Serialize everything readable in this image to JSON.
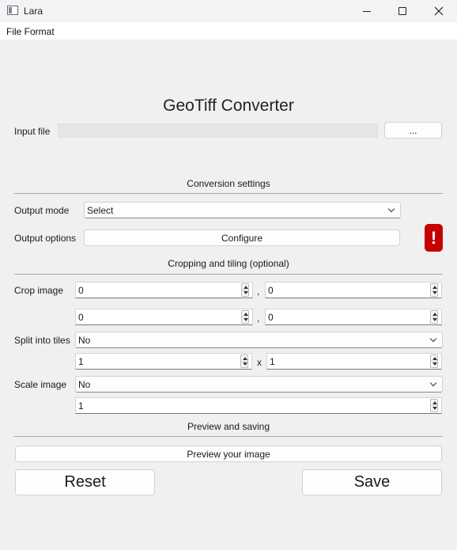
{
  "window": {
    "title": "Lara",
    "icon": "app-window-icon"
  },
  "menu": {
    "items": [
      "File Format"
    ]
  },
  "heading": "GeoTiff Converter",
  "input_file": {
    "label": "Input file",
    "value": "",
    "browse_label": "..."
  },
  "conversion": {
    "title": "Conversion settings",
    "output_mode_label": "Output mode",
    "output_mode_value": "Select",
    "output_options_label": "Output options",
    "configure_label": "Configure",
    "warning_symbol": "!",
    "warning_color": "#c40000"
  },
  "cropping": {
    "title": "Cropping and tiling (optional)",
    "crop_label": "Crop image",
    "crop_values": [
      "0",
      "0",
      "0",
      "0"
    ],
    "crop_separator": ",",
    "split_label": "Split into tiles",
    "split_value": "No",
    "tiles": [
      "1",
      "1"
    ],
    "tiles_separator": "x",
    "scale_label": "Scale image",
    "scale_value": "No",
    "scale_factor": "1"
  },
  "preview": {
    "title": "Preview and saving",
    "preview_label": "Preview your image",
    "reset_label": "Reset",
    "save_label": "Save"
  }
}
